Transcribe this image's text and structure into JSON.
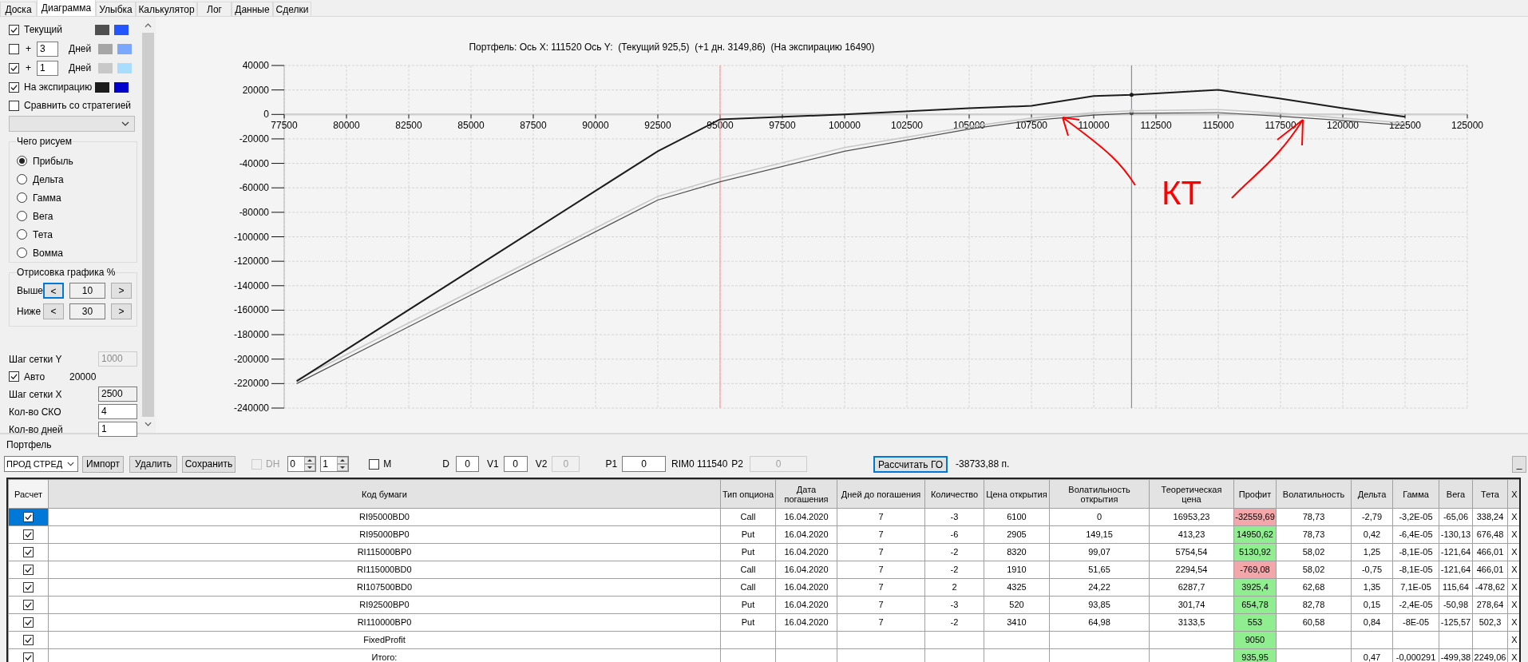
{
  "tabs": [
    {
      "label": "Доска",
      "selected": false
    },
    {
      "label": "Диаграмма",
      "selected": true
    },
    {
      "label": "Улыбка",
      "selected": false
    },
    {
      "label": "Калькулятор",
      "selected": false
    },
    {
      "label": "Лог",
      "selected": false
    },
    {
      "label": "Данные",
      "selected": false
    },
    {
      "label": "Сделки",
      "selected": false
    }
  ],
  "left_panel": {
    "series_rows": [
      {
        "kind": "plain",
        "checked": true,
        "label": "Текущий",
        "swatches": [
          {
            "color": "#505050"
          },
          {
            "color": "#2255ff"
          }
        ]
      },
      {
        "kind": "days",
        "checked": false,
        "sign": "+",
        "days": "3",
        "unit": "Дней",
        "swatches": [
          {
            "color": "#a6a6a6"
          },
          {
            "color": "#7aa7ff"
          }
        ]
      },
      {
        "kind": "days",
        "checked": true,
        "sign": "+",
        "days": "1",
        "unit": "Дней",
        "swatches": [
          {
            "color": "#c8c8c8"
          },
          {
            "color": "#a8ddff"
          }
        ]
      },
      {
        "kind": "plain",
        "checked": true,
        "label": "На экспирацию",
        "swatches": [
          {
            "color": "#1c1c1c"
          },
          {
            "color": "#0000cc"
          }
        ]
      }
    ],
    "compare": {
      "checked": false,
      "label": "Сравнить со стратегией"
    },
    "draw_group": {
      "title": "Чего рисуем",
      "options": [
        {
          "label": "Прибыль",
          "selected": true
        },
        {
          "label": "Дельта",
          "selected": false
        },
        {
          "label": "Гамма",
          "selected": false
        },
        {
          "label": "Вега",
          "selected": false
        },
        {
          "label": "Тета",
          "selected": false
        },
        {
          "label": "Вомма",
          "selected": false
        }
      ]
    },
    "range_group": {
      "title": "Отрисовка графика %",
      "rows": [
        {
          "label": "Выше",
          "dec": "<",
          "value": "10",
          "inc": ">",
          "focused": true
        },
        {
          "label": "Ниже",
          "dec": "<",
          "value": "30",
          "inc": ">",
          "focused": false
        }
      ]
    },
    "settings": [
      {
        "kind": "field",
        "label": "Шаг сетки Y",
        "value": "1000",
        "disabled": true
      },
      {
        "kind": "checkbox",
        "label": "Авто",
        "checked": true,
        "value": "20000"
      },
      {
        "kind": "field",
        "label": "Шаг сетки X",
        "value": "2500",
        "disabled": false,
        "readonly": true
      },
      {
        "kind": "field",
        "label": "Кол-во СКО",
        "value": "4",
        "disabled": false,
        "readonly": false
      },
      {
        "kind": "field",
        "label": "Кол-во дней",
        "value": "1",
        "disabled": false,
        "readonly": false
      }
    ]
  },
  "chart": {
    "chart_data": {
      "type": "line",
      "title": "Портфель: Ось X: 111520 Ось Y:  (Текущий 925,5)  (+1 дн. 3149,86)  (На экспирацию 16490)",
      "x": [
        78000,
        92500,
        95000,
        100000,
        105000,
        107500,
        110000,
        111520,
        115000,
        117500,
        120000,
        122500
      ],
      "series": [
        {
          "color": "#505050",
          "values": [
            -220000,
            -70000,
            -55000,
            -30000,
            -12000,
            -5000,
            -500,
            1000,
            1500,
            -1500,
            -5000,
            -9000
          ]
        },
        {
          "color": "#c8c8c8",
          "values": [
            -217000,
            -67000,
            -52000,
            -27000,
            -10000,
            -3000,
            1500,
            3000,
            4000,
            1000,
            -3000,
            -7000
          ]
        },
        {
          "color": "#1c1c1c",
          "values": [
            -218000,
            -30000,
            -4000,
            0,
            5000,
            7000,
            15000,
            16000,
            20000,
            13000,
            5000,
            -2000
          ]
        }
      ],
      "grid": true,
      "ref_lines": [
        {
          "axis": "x",
          "value": 95000,
          "color": "#ff9a9a"
        },
        {
          "axis": "x",
          "value": 111520,
          "color": "#8a8e96"
        }
      ],
      "xlim": [
        77500,
        125000
      ],
      "ylim": [
        -240000,
        40000
      ],
      "xticks": [
        77500,
        80000,
        82500,
        85000,
        87500,
        90000,
        92500,
        95000,
        97500,
        100000,
        102500,
        105000,
        107500,
        110000,
        112500,
        115000,
        117500,
        120000,
        122500,
        125000
      ],
      "yticks": [
        40000,
        20000,
        0,
        -20000,
        -40000,
        -60000,
        -80000,
        -100000,
        -120000,
        -140000,
        -160000,
        -180000,
        -200000,
        -220000,
        -240000
      ],
      "annotations": [
        {
          "text": "КТ"
        }
      ]
    }
  },
  "portfolio": {
    "title": "Портфель",
    "toolbar": [
      {
        "kind": "select",
        "value": "ПРОД СТРЕД"
      },
      {
        "kind": "button",
        "label": "Импорт",
        "focused": false
      },
      {
        "kind": "button",
        "label": "Удалить",
        "focused": false
      },
      {
        "kind": "button",
        "label": "Сохранить",
        "focused": false
      },
      {
        "kind": "checkbox",
        "label": "DH",
        "checked": false,
        "disabled": true
      },
      {
        "kind": "spinner",
        "value": "0"
      },
      {
        "kind": "spinner",
        "value": "1"
      },
      {
        "kind": "checkbox",
        "label": "M",
        "checked": false,
        "disabled": false
      },
      {
        "kind": "label",
        "text": "D"
      },
      {
        "kind": "field",
        "value": "0",
        "disabled": false
      },
      {
        "kind": "label",
        "text": "V1"
      },
      {
        "kind": "field",
        "value": "0",
        "disabled": false
      },
      {
        "kind": "label",
        "text": "V2"
      },
      {
        "kind": "field",
        "value": "0",
        "disabled": true
      },
      {
        "kind": "label",
        "text": "P1"
      },
      {
        "kind": "field",
        "value": "0",
        "disabled": false
      },
      {
        "kind": "label",
        "text": "RIM0 111540"
      },
      {
        "kind": "label",
        "text": "P2"
      },
      {
        "kind": "field",
        "value": "0",
        "disabled": true
      },
      {
        "kind": "button",
        "label": "Рассчитать ГО",
        "focused": true
      },
      {
        "kind": "label",
        "text": "-38733,88 п."
      },
      {
        "kind": "button",
        "label": "_",
        "focused": false
      }
    ],
    "table": {
      "columns": [
        "Расчет",
        "Код бумаги",
        "Тип опциона",
        "Дата погашения",
        "Дней до погашения",
        "Количество",
        "Цена открытия",
        "Волатильность открытия",
        "Теоретическая цена",
        "Профит",
        "Волатильность",
        "Дельта",
        "Гамма",
        "Вега",
        "Тета",
        "X"
      ],
      "rows": [
        {
          "checked": true,
          "selected": true,
          "color": "#f4a7ab",
          "code": "RI95000BD0",
          "type": "Call",
          "date": "16.04.2020",
          "days": "7",
          "qty": "-3",
          "open_price": "6100",
          "open_vol": "0",
          "theor_price": "16953,23",
          "profit": "-32559,69",
          "vol": "78,73",
          "delta": "-2,79",
          "gamma": "-3,2E-05",
          "vega": "-65,06",
          "theta": "338,24",
          "remove": "X"
        },
        {
          "checked": true,
          "selected": false,
          "color": "#90ee90",
          "code": "RI95000BP0",
          "type": "Put",
          "date": "16.04.2020",
          "days": "7",
          "qty": "-6",
          "open_price": "2905",
          "open_vol": "149,15",
          "theor_price": "413,23",
          "profit": "14950,62",
          "vol": "78,73",
          "delta": "0,42",
          "gamma": "-6,4E-05",
          "vega": "-130,13",
          "theta": "676,48",
          "remove": "X"
        },
        {
          "checked": true,
          "selected": false,
          "color": "#90ee90",
          "code": "RI115000BP0",
          "type": "Put",
          "date": "16.04.2020",
          "days": "7",
          "qty": "-2",
          "open_price": "8320",
          "open_vol": "99,07",
          "theor_price": "5754,54",
          "profit": "5130,92",
          "vol": "58,02",
          "delta": "1,25",
          "gamma": "-8,1E-05",
          "vega": "-121,64",
          "theta": "466,01",
          "remove": "X"
        },
        {
          "checked": true,
          "selected": false,
          "color": "#f4a7ab",
          "code": "RI115000BD0",
          "type": "Call",
          "date": "16.04.2020",
          "days": "7",
          "qty": "-2",
          "open_price": "1910",
          "open_vol": "51,65",
          "theor_price": "2294,54",
          "profit": "-769,08",
          "vol": "58,02",
          "delta": "-0,75",
          "gamma": "-8,1E-05",
          "vega": "-121,64",
          "theta": "466,01",
          "remove": "X"
        },
        {
          "checked": true,
          "selected": false,
          "color": "#90ee90",
          "code": "RI107500BD0",
          "type": "Call",
          "date": "16.04.2020",
          "days": "7",
          "qty": "2",
          "open_price": "4325",
          "open_vol": "24,22",
          "theor_price": "6287,7",
          "profit": "3925,4",
          "vol": "62,68",
          "delta": "1,35",
          "gamma": "7,1E-05",
          "vega": "115,64",
          "theta": "-478,62",
          "remove": "X"
        },
        {
          "checked": true,
          "selected": false,
          "color": "#90ee90",
          "code": "RI92500BP0",
          "type": "Put",
          "date": "16.04.2020",
          "days": "7",
          "qty": "-3",
          "open_price": "520",
          "open_vol": "93,85",
          "theor_price": "301,74",
          "profit": "654,78",
          "vol": "82,78",
          "delta": "0,15",
          "gamma": "-2,4E-05",
          "vega": "-50,98",
          "theta": "278,64",
          "remove": "X"
        },
        {
          "checked": true,
          "selected": false,
          "color": "#90ee90",
          "code": "RI110000BP0",
          "type": "Put",
          "date": "16.04.2020",
          "days": "7",
          "qty": "-2",
          "open_price": "3410",
          "open_vol": "64,98",
          "theor_price": "3133,5",
          "profit": "553",
          "vol": "60,58",
          "delta": "0,84",
          "gamma": "-8E-05",
          "vega": "-125,57",
          "theta": "502,3",
          "remove": "X"
        },
        {
          "checked": true,
          "selected": false,
          "color": "#90ee90",
          "code": "FixedProfit",
          "profit": "9050",
          "remove": "X"
        },
        {
          "checked": true,
          "selected": false,
          "color": "#90ee90",
          "code": "Итого:",
          "profit": "935,95",
          "delta": "0,47",
          "gamma": "-0,000291",
          "vega": "-499,38",
          "theta": "2249,06",
          "remove": "X"
        }
      ]
    }
  }
}
